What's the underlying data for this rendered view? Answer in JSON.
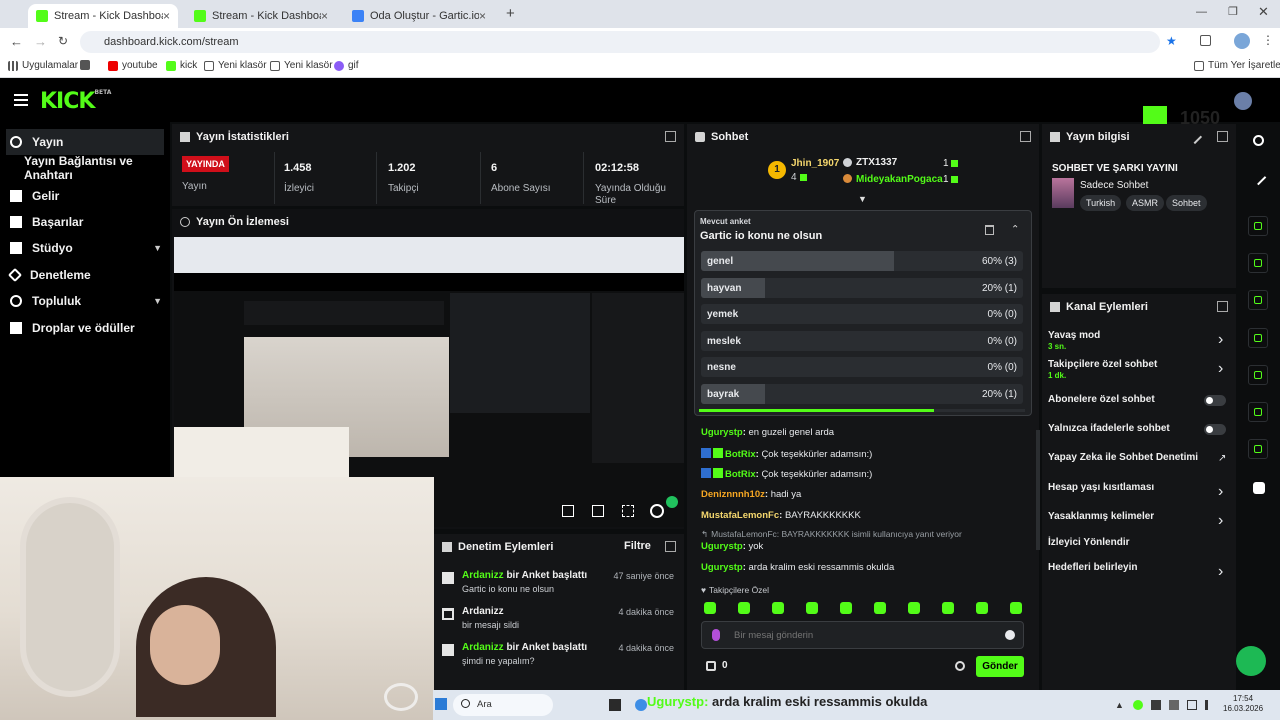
{
  "browser": {
    "tabs": [
      {
        "label": "Stream - Kick Dashboard",
        "active": true
      },
      {
        "label": "Stream - Kick Dashboard",
        "active": false
      },
      {
        "label": "Oda Oluştur - Gartic.io",
        "active": false
      }
    ],
    "new_tab": "+",
    "url": "dashboard.kick.com/stream",
    "bookmarks": [
      "Uygulamalar",
      "youtube",
      "kick",
      "Yeni klasör",
      "Yeni klasör",
      "gif"
    ],
    "all_bookmarks": "Tüm Yer İşaretleri"
  },
  "kick": {
    "logo": "KICK",
    "logo_badge": "BETA",
    "overlay_logo_count": "1050"
  },
  "sidebar": {
    "items": [
      {
        "label": "Yayın",
        "icon": "broadcast-icon"
      },
      {
        "label": "Yayın Bağlantısı ve Anahtarı",
        "icon": ""
      },
      {
        "label": "Gelir",
        "icon": "revenue-icon"
      },
      {
        "label": "Başarılar",
        "icon": "achievements-icon"
      },
      {
        "label": "Stüdyo",
        "icon": "studio-icon"
      },
      {
        "label": "Denetleme",
        "icon": "wrench-icon"
      },
      {
        "label": "Topluluk",
        "icon": "community-icon"
      },
      {
        "label": "Droplar ve ödüller",
        "icon": "drops-icon"
      }
    ]
  },
  "stats": {
    "title": "Yayın İstatistikleri",
    "live_badge": "YAYINDA",
    "live_label": "Yayın",
    "items": [
      {
        "value": "1.458",
        "label": "İzleyici"
      },
      {
        "value": "1.202",
        "label": "Takipçi"
      },
      {
        "value": "6",
        "label": "Abone Sayısı"
      },
      {
        "value": "02:12:58",
        "label": "Yayında Olduğu Süre"
      }
    ]
  },
  "preview": {
    "title": "Yayın Ön İzlemesi"
  },
  "moderation": {
    "title": "Denetim Eylemleri",
    "filter": "Filtre",
    "items": [
      {
        "user": "Ardanizz",
        "action": "bir Anket başlattı",
        "detail": "Gartic io konu ne olsun",
        "time": "47 saniye önce"
      },
      {
        "user": "Ardanizz",
        "action": "",
        "detail": "bir mesajı sildi",
        "time": "4 dakika önce"
      },
      {
        "user": "Ardanizz",
        "action": "bir Anket başlattı",
        "detail": "şimdi ne yapalım?",
        "time": "4 dakika önce"
      }
    ]
  },
  "chat": {
    "title": "Sohbet",
    "leaderboard": [
      {
        "rank": "1",
        "name": "Jhin_1907",
        "count": "4"
      },
      {
        "rank": "",
        "name": "ZTX1337",
        "count": "1"
      },
      {
        "rank": "",
        "name": "MideyakanPogaca",
        "count": "1"
      }
    ],
    "poll": {
      "label": "Mevcut anket",
      "question": "Gartic io konu ne olsun",
      "options": [
        {
          "name": "genel",
          "percent": 60,
          "text": "60% (3)"
        },
        {
          "name": "hayvan",
          "percent": 20,
          "text": "20% (1)"
        },
        {
          "name": "yemek",
          "percent": 0,
          "text": "0% (0)"
        },
        {
          "name": "meslek",
          "percent": 0,
          "text": "0% (0)"
        },
        {
          "name": "nesne",
          "percent": 0,
          "text": "0% (0)"
        },
        {
          "name": "bayrak",
          "percent": 20,
          "text": "20% (1)"
        }
      ],
      "time_left_fraction": 0.72
    },
    "messages": [
      {
        "user": "Ugurystp",
        "text": "en guzeli genel arda",
        "color": "#53fc18",
        "bot": false
      },
      {
        "user": "BotRix",
        "text": "Çok teşekkürler adamsın:)",
        "color": "#53fc18",
        "bot": true
      },
      {
        "user": "BotRix",
        "text": "Çok teşekkürler adamsın:)",
        "color": "#53fc18",
        "bot": true
      },
      {
        "user": "Deniznnnh10z",
        "text": "hadi ya",
        "color": "#f5a623",
        "bot": false
      },
      {
        "user": "MustafaLemonFc",
        "text": "BAYRAKKKKKKK",
        "color": "#f5d76e",
        "bot": false
      },
      {
        "user": "Ugurystp",
        "text": "yok",
        "color": "#53fc18",
        "bot": false
      },
      {
        "user": "Ugurystp",
        "text": "arda kralim eski ressammis okulda",
        "color": "#53fc18",
        "bot": false
      }
    ],
    "reply_hint": "MustafaLemonFc: BAYRAKKKKKKK isimli kullanıcıya yanıt veriyor",
    "followers_only": "Takipçilere Özel",
    "placeholder": "Bir mesaj gönderin",
    "points": "0",
    "send": "Gönder"
  },
  "stream_info": {
    "title": "Yayın bilgisi",
    "stream_title": "SOHBET VE ŞARKI YAYINI",
    "category": "Sadece Sohbet",
    "tags": [
      "Turkish",
      "ASMR",
      "Sohbet"
    ]
  },
  "channel_actions": {
    "title": "Kanal Eylemleri",
    "items": [
      {
        "label": "Yavaş mod",
        "sub": "3 sn.",
        "control": "arrow"
      },
      {
        "label": "Takipçilere özel sohbet",
        "sub": "1 dk.",
        "control": "arrow"
      },
      {
        "label": "Abonelere özel sohbet",
        "sub": "",
        "control": "toggle"
      },
      {
        "label": "Yalnızca ifadelerle sohbet",
        "sub": "",
        "control": "toggle"
      },
      {
        "label": "Yapay Zeka ile Sohbet Denetimi",
        "sub": "",
        "control": "external"
      },
      {
        "label": "Hesap yaşı kısıtlaması",
        "sub": "",
        "control": "arrow"
      },
      {
        "label": "Yasaklanmış kelimeler",
        "sub": "",
        "control": "arrow"
      },
      {
        "label": "İzleyici Yönlendir",
        "sub": "",
        "control": "none"
      },
      {
        "label": "Hedefleri belirleyin",
        "sub": "",
        "control": "arrow"
      }
    ]
  },
  "taskbar": {
    "search": "Ara",
    "time": "17:54",
    "date": "16.03.2026",
    "overlay_user": "Ugurystp",
    "overlay_text": "arda kralim eski ressammis okulda"
  }
}
